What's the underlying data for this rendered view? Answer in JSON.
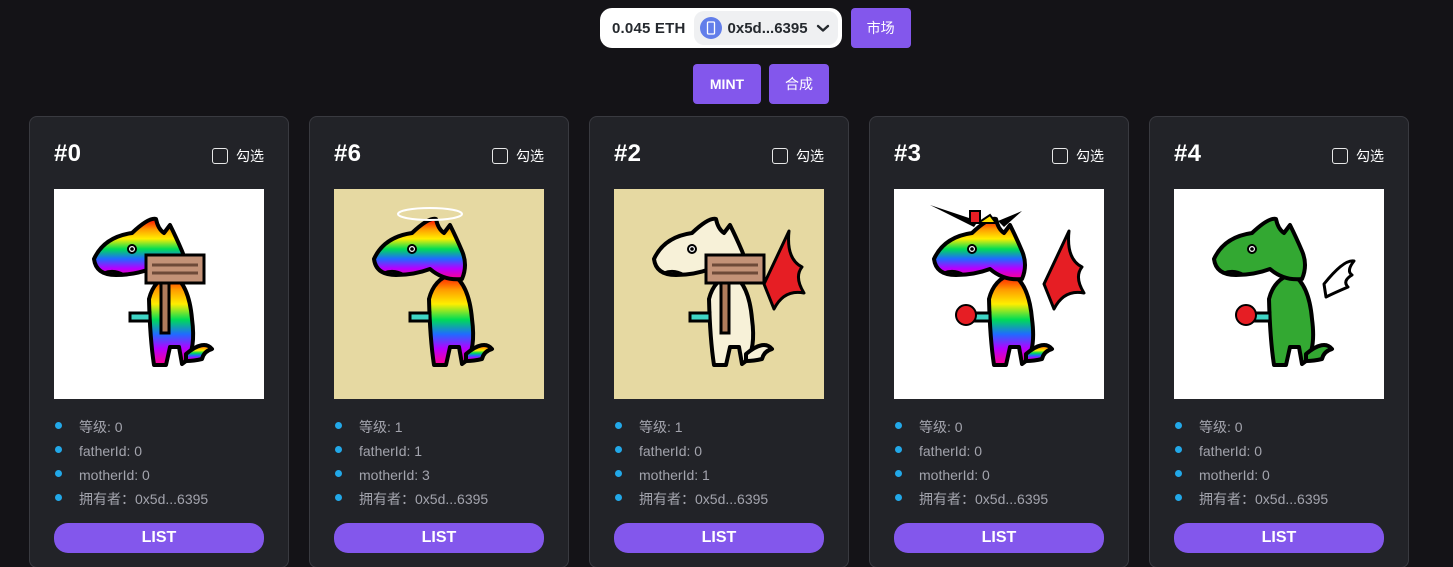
{
  "wallet": {
    "balance": "0.045 ETH",
    "address": "0x5d...6395",
    "chain_icon": "ethereum-icon"
  },
  "nav": {
    "market_label": "市场"
  },
  "actions": {
    "mint_label": "MINT",
    "merge_label": "合成"
  },
  "checkbox_label": "勾选",
  "list_label": "LIST",
  "labels": {
    "level": "等级: ",
    "father": "fatherId: ",
    "mother": "motherId: ",
    "owner": "拥有者：",
    "owner_value": "0x5d...6395"
  },
  "cards": [
    {
      "id": "#0",
      "level": "0",
      "father": "0",
      "mother": "0",
      "bg": "#ffffff",
      "body": "rainbow",
      "accessory": "sign",
      "extra": "none"
    },
    {
      "id": "#6",
      "level": "1",
      "father": "1",
      "mother": "3",
      "bg": "#e6d9a2",
      "body": "rainbow",
      "accessory": "halo",
      "extra": "none"
    },
    {
      "id": "#2",
      "level": "1",
      "father": "0",
      "mother": "1",
      "bg": "#e6d9a2",
      "body": "cream",
      "accessory": "sign",
      "extra": "devil-wing"
    },
    {
      "id": "#3",
      "level": "0",
      "father": "0",
      "mother": "0",
      "bg": "#ffffff",
      "body": "rainbow",
      "accessory": "horns",
      "extra": "devil-wing-ball"
    },
    {
      "id": "#4",
      "level": "0",
      "father": "0",
      "mother": "0",
      "bg": "#ffffff",
      "body": "green",
      "accessory": "none",
      "extra": "angel-wing-ball"
    }
  ]
}
